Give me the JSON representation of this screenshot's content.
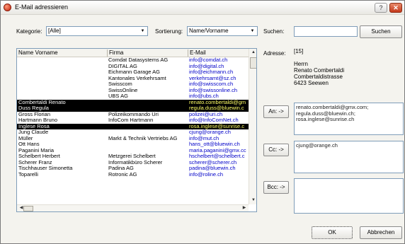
{
  "window": {
    "title": "E-Mail adressieren",
    "help_glyph": "?",
    "close_glyph": "✕"
  },
  "filters": {
    "kategorie_label": "Kategorie:",
    "kategorie_value": "[Alle]",
    "sortierung_label": "Sortierung:",
    "sortierung_value": "Name/Vorname",
    "suchen_label": "Suchen:",
    "suchen_value": "",
    "suchen_button": "Suchen",
    "dropdown_glyph": "▼"
  },
  "list": {
    "columns": [
      "Name Vorname",
      "Firma",
      "E-Mail"
    ],
    "rows": [
      {
        "name": "",
        "firma": "Comdat Datasystems AG",
        "email": "info@comdat.ch",
        "selected": false
      },
      {
        "name": "",
        "firma": "DIGITAL AG",
        "email": "info@digital.ch",
        "selected": false
      },
      {
        "name": "",
        "firma": "Eichmann Garage AG",
        "email": "info@eichmann.ch",
        "selected": false
      },
      {
        "name": "",
        "firma": "Kantonales Verkehrsamt",
        "email": "verkehrsamt@sz.ch",
        "selected": false
      },
      {
        "name": "",
        "firma": "Swisscom",
        "email": "info@swisscom.ch",
        "selected": false
      },
      {
        "name": "",
        "firma": "SwissOnline",
        "email": "info@swissonline.ch",
        "selected": false
      },
      {
        "name": "",
        "firma": "UBS AG",
        "email": "info@ubs.ch",
        "selected": false
      },
      {
        "name": "Combertaldi Renato",
        "firma": "",
        "email": "renato.combertaldi@gm",
        "selected": true
      },
      {
        "name": "Duss Regula",
        "firma": "",
        "email": "regula.duss@bluewin.c",
        "selected": true
      },
      {
        "name": "Gross Florian",
        "firma": "Polizeikommando Uri",
        "email": "polizei@uri.ch",
        "selected": false
      },
      {
        "name": "Hartmann Bruno",
        "firma": "InfoCom Hartmann",
        "email": "info@InfoComNet.ch",
        "selected": false
      },
      {
        "name": "Inglese Rosa",
        "firma": "",
        "email": "rosa.inglese@sunrise.c",
        "selected": true
      },
      {
        "name": "Jung Claude",
        "firma": "",
        "email": "cjung@orange.ch",
        "selected": false
      },
      {
        "name": "Müller",
        "firma": "Markt & Technik Vertriebs AG",
        "email": "info@mut.ch",
        "selected": false
      },
      {
        "name": "Ott Hans",
        "firma": "",
        "email": "hans_ott@bluewin.ch",
        "selected": false
      },
      {
        "name": "Paganini Maria",
        "firma": "",
        "email": "maria.paganini@gmx.cc",
        "selected": false
      },
      {
        "name": "Schelbert Herbert",
        "firma": "Metzgerei Schelbert",
        "email": "hschelbert@schelbert.c",
        "selected": false
      },
      {
        "name": "Scherer Franz",
        "firma": "Informatikbüro Scherer",
        "email": "scherer@scherer.ch",
        "selected": false
      },
      {
        "name": "Tischhauser Simonetta",
        "firma": "Padina AG",
        "email": "padina@bluewin.ch",
        "selected": false
      },
      {
        "name": "Toparelli",
        "firma": "Rotronic AG",
        "email": "info@roline.ch",
        "selected": false
      }
    ]
  },
  "adresse": {
    "label": "Adresse:",
    "lines": [
      "[15]",
      "",
      "Herrn",
      "Renato Combertaldi",
      "Combertaldistrasse",
      "6423 Seewen"
    ]
  },
  "recipients": {
    "an_button": "An: ->",
    "an_list": [
      "renato.combertaldi@gmx.com;",
      "regula.duss@bluewin.ch;",
      "rosa.inglese@sunrise.ch"
    ],
    "cc_button": "Cc: ->",
    "cc_list": [
      "cjung@orange.ch"
    ],
    "bcc_button": "Bcc: ->",
    "bcc_list": []
  },
  "footer": {
    "ok_button": "OK",
    "cancel_button": "Abbrechen"
  },
  "colors": {
    "selection_bg": "#000000",
    "selection_email": "#ffff66",
    "email_text": "#0000c8"
  }
}
